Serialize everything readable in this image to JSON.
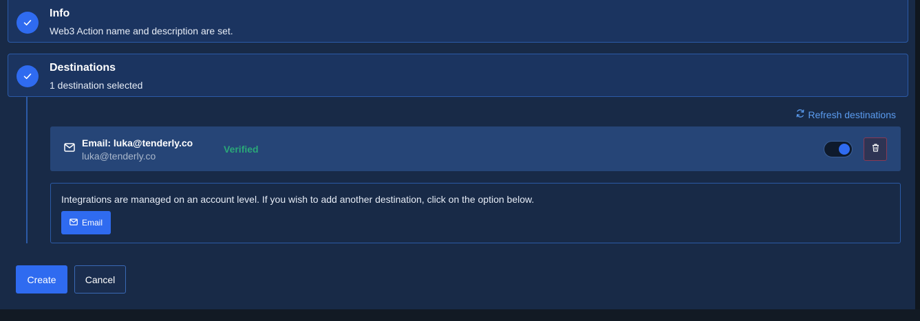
{
  "steps": {
    "info": {
      "title": "Info",
      "description": "Web3 Action name and description are set.",
      "icon": "check-icon"
    },
    "destinations": {
      "title": "Destinations",
      "description": "1 destination selected",
      "icon": "check-icon"
    }
  },
  "refresh": {
    "label": "Refresh destinations",
    "icon": "refresh-icon"
  },
  "destination": {
    "name": "Email: luka@tenderly.co",
    "address": "luka@tenderly.co",
    "status": "Verified",
    "enabled": true,
    "icon": "mail-icon"
  },
  "integrations": {
    "text": "Integrations are managed on an account level. If you wish to add another destination, click on the option below.",
    "email_button": "Email"
  },
  "actions": {
    "create": "Create",
    "cancel": "Cancel"
  },
  "colors": {
    "accent": "#2f6bf0",
    "verified": "#2aa878",
    "link": "#5b9cf0",
    "panel": "#182a47",
    "border": "#2c5ba8"
  }
}
